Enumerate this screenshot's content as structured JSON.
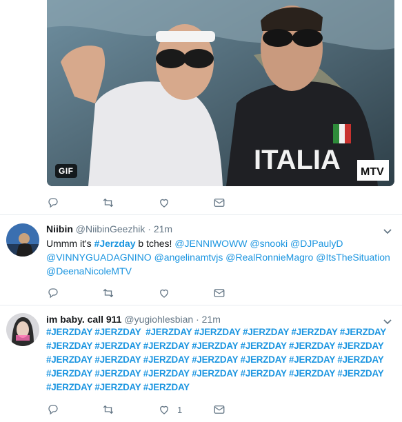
{
  "media": {
    "badge": "GIF",
    "watermark": "MTV",
    "shirt_text": "ITALIA"
  },
  "top_actions": {
    "reply_icon": "reply-icon",
    "retweet_icon": "retweet-icon",
    "like_icon": "heart-icon",
    "dm_icon": "envelope-icon"
  },
  "tweet1": {
    "name": "Niibin",
    "handle": "@NiibinGeezhik",
    "dot": "·",
    "time": "21m",
    "text_prefix": "Ummm it's ",
    "hashtag": "#Jerzday",
    "text_mid": " b tches! ",
    "mentions": [
      "@JENNIWOWW",
      "@snooki",
      "@DJPaulyD",
      "@VINNYGUADAGNINO",
      "@angelinamtvjs",
      "@RealRonnieMagro",
      "@ItsTheSituation",
      "@DeenaNicoleMTV"
    ]
  },
  "tweet2": {
    "name": "im baby. call 911",
    "handle": "@yugiohlesbian",
    "dot": "·",
    "time": "21m",
    "hashtag_lines": [
      "#JERZDAY #JERZDAY  #JERZDAY #JERZDAY #JERZDAY #JERZDAY #JERZDAY",
      "#JERZDAY #JERZDAY #JERZDAY #JERZDAY #JERZDAY #JERZDAY #JERZDAY",
      "#JERZDAY #JERZDAY #JERZDAY #JERZDAY #JERZDAY #JERZDAY #JERZDAY",
      "#JERZDAY #JERZDAY #JERZDAY #JERZDAY #JERZDAY #JERZDAY #JERZDAY",
      "#JERZDAY #JERZDAY #JERZDAY"
    ],
    "like_count": "1"
  },
  "colors": {
    "link": "#1b95e0",
    "text": "#14171a",
    "muted": "#657786",
    "divider": "#e6ecf0"
  }
}
